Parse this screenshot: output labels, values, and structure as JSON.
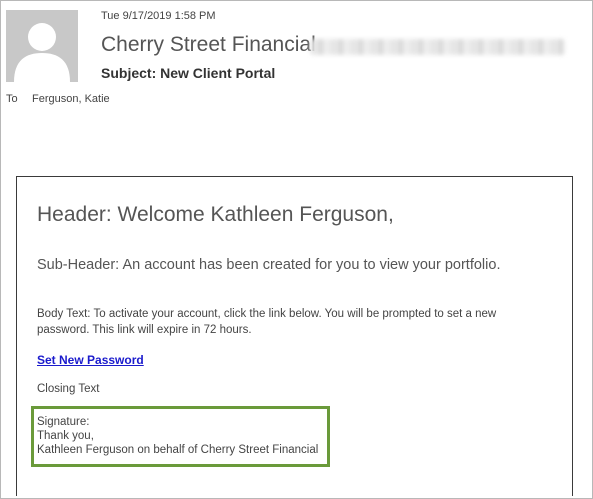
{
  "message": {
    "date": "Tue 9/17/2019 1:58 PM",
    "sender_name": "Cherry Street Financial",
    "subject": "Subject: New Client Portal",
    "to_label": "To",
    "to_value": "Ferguson, Katie"
  },
  "body": {
    "header": "Header: Welcome Kathleen Ferguson,",
    "sub_header": "Sub-Header: An account has been created for you to view your portfolio.",
    "body_text": "Body Text: To activate your account, click the link below. You will be prompted to set a new password. This link will expire in 72 hours.",
    "link_label": "Set New Password",
    "closing": "Closing Text",
    "signature": {
      "label": "Signature:",
      "line1": "Thank you,",
      "line2": "Kathleen Ferguson on behalf of Cherry Street Financial"
    }
  },
  "colors": {
    "highlight_border": "#6a9a3a",
    "link": "#1a1acc",
    "avatar_bg": "#c8c8c8"
  },
  "icons": {
    "avatar": "person-silhouette-icon"
  }
}
